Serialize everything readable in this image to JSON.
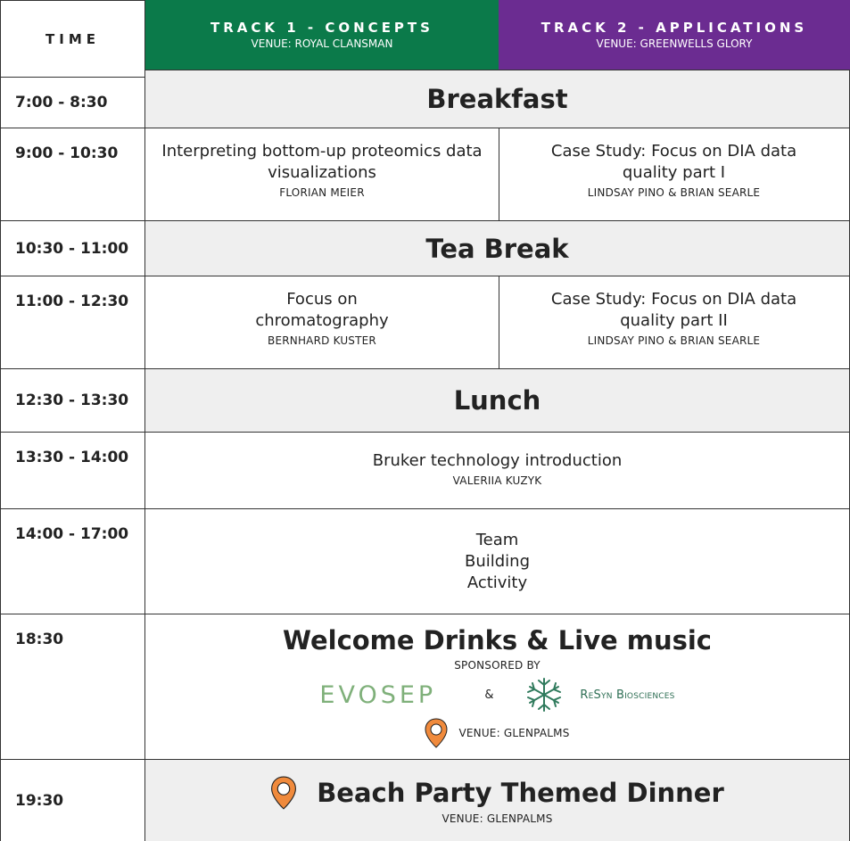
{
  "header": {
    "time_label": "TIME",
    "track1": {
      "title": "TRACK 1 - CONCEPTS",
      "venue": "VENUE: ROYAL CLANSMAN",
      "color": "#0b7a4a"
    },
    "track2": {
      "title": "TRACK 2 - APPLICATIONS",
      "venue": "VENUE: GREENWELLS GLORY",
      "color": "#6b2c91"
    }
  },
  "rows": [
    {
      "time": "7:00 - 8:30",
      "title": "Breakfast"
    },
    {
      "time": "9:00 - 10:30",
      "track1": {
        "title": "Interpreting bottom-up proteomics data visualizations",
        "speaker": "FLORIAN MEIER"
      },
      "track2": {
        "title": "Case Study: Focus on DIA data quality part I",
        "speaker": "LINDSAY PINO & BRIAN SEARLE"
      }
    },
    {
      "time": "10:30 - 11:00",
      "title": "Tea Break"
    },
    {
      "time": "11:00 - 12:30",
      "track1": {
        "title": "Focus on chromatography",
        "speaker": "BERNHARD KUSTER"
      },
      "track2": {
        "title": "Case Study: Focus on DIA data quality part II",
        "speaker": "LINDSAY PINO & BRIAN SEARLE"
      }
    },
    {
      "time": "12:30 - 13:30",
      "title": "Lunch"
    },
    {
      "time": "13:30 - 14:00",
      "title": "Bruker technology introduction",
      "speaker": "VALERIIA KUZYK"
    },
    {
      "time": "14:00 - 17:00",
      "title_lines": [
        "Team",
        "Building",
        "Activity"
      ]
    },
    {
      "time": "18:30",
      "title": "Welcome Drinks & Live music",
      "sponsored_label": "SPONSORED BY",
      "sponsor1": "EVOSEP",
      "amp": "&",
      "sponsor2": "ReSyn Biosciences",
      "venue": "VENUE: GLENPALMS"
    },
    {
      "time": "19:30",
      "title": "Beach Party Themed Dinner",
      "venue": "VENUE: GLENPALMS"
    }
  ],
  "icons": {
    "pin": "map-pin-icon",
    "pin_color": "#f08a3c"
  }
}
